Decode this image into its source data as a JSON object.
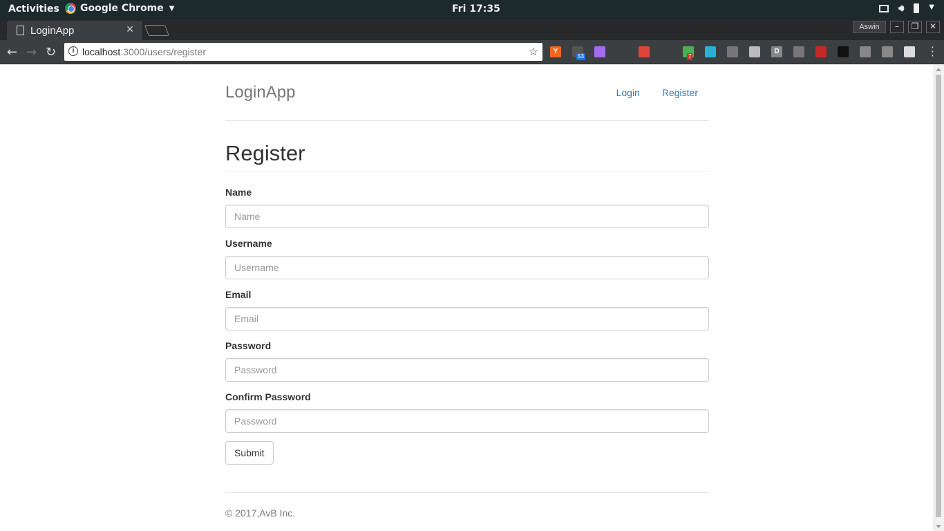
{
  "system_bar": {
    "activities": "Activities",
    "app_name": "Google Chrome",
    "clock": "Fri 17:35"
  },
  "browser": {
    "tab_title": "LoginApp",
    "user": "Aswin",
    "url_host": "localhost",
    "url_rest": ":3000/users/register",
    "extensions": [
      {
        "icon": "y-combinator-icon",
        "label": "Y",
        "color": "#f26522"
      },
      {
        "icon": "extension-badge-icon",
        "label": "",
        "color": "#555",
        "badge": "53",
        "badge_color": "#1a73e8"
      },
      {
        "icon": "feather-icon",
        "label": "",
        "color": "#a36cf0"
      },
      {
        "icon": "bus-icon",
        "label": "",
        "color": "#3c3f42"
      },
      {
        "icon": "color-wheel-icon",
        "label": "",
        "color": "#e0443a"
      },
      {
        "icon": "gnome-foot-icon",
        "label": "",
        "color": "#3c3f42"
      },
      {
        "icon": "download-arrow-icon",
        "label": "",
        "color": "#4caf50",
        "badge": "7",
        "badge_color": "#d32f2f"
      },
      {
        "icon": "heart-icon",
        "label": "",
        "color": "#2ab0d8"
      },
      {
        "icon": "video-icon",
        "label": "",
        "color": "#777"
      },
      {
        "icon": "box-icon",
        "label": "",
        "color": "#bbb"
      },
      {
        "icon": "d-icon",
        "label": "D",
        "color": "#888"
      },
      {
        "icon": "pocket-icon",
        "label": "",
        "color": "#777"
      },
      {
        "icon": "red-forward-icon",
        "label": "",
        "color": "#c62828"
      },
      {
        "icon": "magnifier-icon",
        "label": "",
        "color": "#111"
      },
      {
        "icon": "github-icon",
        "label": "",
        "color": "#888"
      },
      {
        "icon": "search-icon",
        "label": "",
        "color": "#888"
      },
      {
        "icon": "flag-icon",
        "label": "",
        "color": "#ddd"
      }
    ]
  },
  "site": {
    "brand": "LoginApp",
    "nav": [
      "Login",
      "Register"
    ],
    "heading": "Register",
    "fields": [
      {
        "label": "Name",
        "placeholder": "Name"
      },
      {
        "label": "Username",
        "placeholder": "Username"
      },
      {
        "label": "Email",
        "placeholder": "Email"
      },
      {
        "label": "Password",
        "placeholder": "Password"
      },
      {
        "label": "Confirm Password",
        "placeholder": "Password"
      }
    ],
    "submit": "Submit",
    "footer": "© 2017,AvB Inc."
  },
  "colors": {
    "link": "#337ab7",
    "brand_text": "#777777",
    "system_bar_bg": "#1c2a2b",
    "toolbar_bg": "#3c3f42"
  }
}
